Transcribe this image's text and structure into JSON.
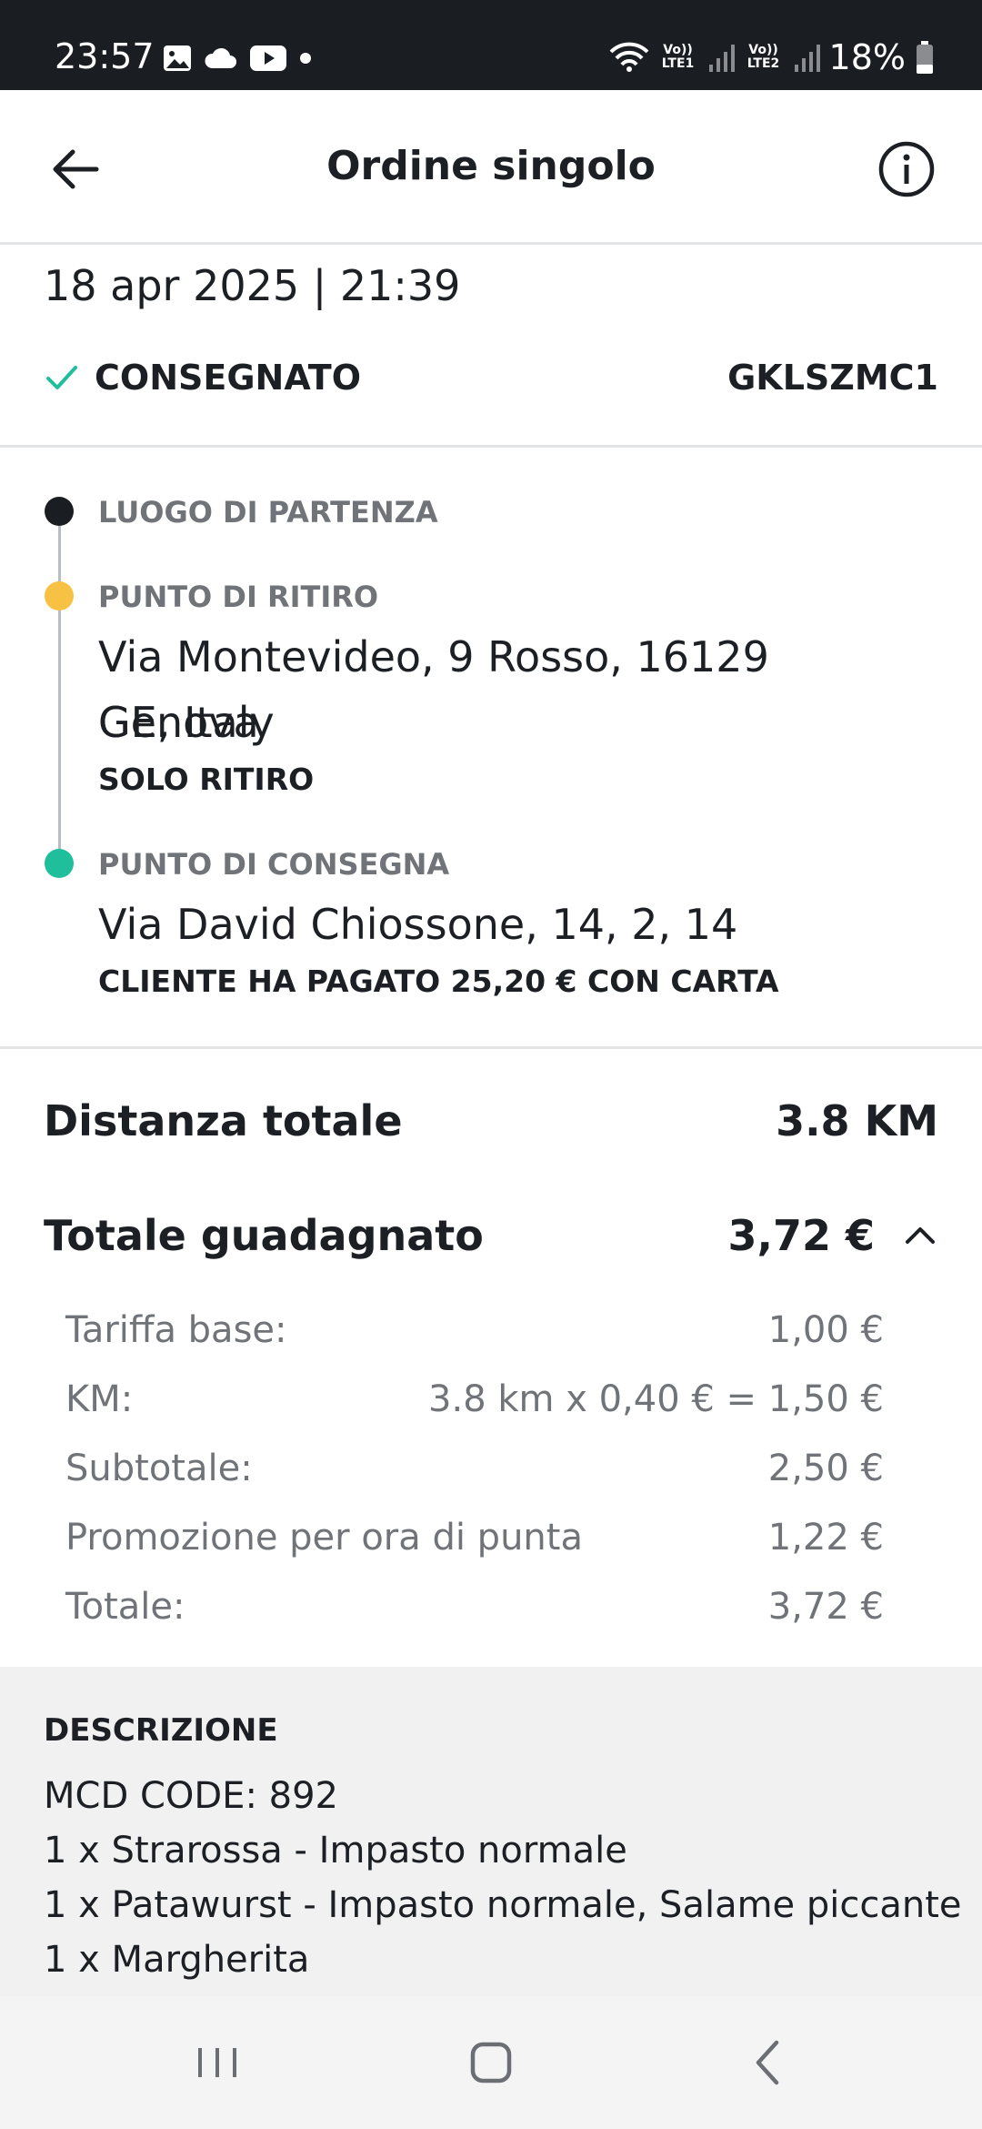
{
  "status_bar": {
    "time": "23:57",
    "lte1": "Vo)) LTE1",
    "lte2": "Vo)) LTE2",
    "battery": "18%"
  },
  "header": {
    "title": "Ordine singolo"
  },
  "order": {
    "datetime": "18 apr 2025 | 21:39",
    "status": "CONSEGNATO",
    "code": "GKLSZMC1"
  },
  "route": {
    "start_label": "LUOGO DI PARTENZA",
    "pickup_label": "PUNTO DI RITIRO",
    "pickup_address_line1": "Via Montevideo, 9 Rosso, 16129 Genova",
    "pickup_address_line2": "GE, Italy",
    "pickup_note": "SOLO RITIRO",
    "dropoff_label": "PUNTO DI CONSEGNA",
    "dropoff_address": "Via David Chiossone, 14, 2, 14",
    "dropoff_note": "CLIENTE HA PAGATO 25,20 € CON CARTA"
  },
  "totals": {
    "distance_label": "Distanza totale",
    "distance_value": "3.8 KM",
    "earned_label": "Totale guadagnato",
    "earned_value": "3,72 €",
    "breakdown": [
      {
        "label": "Tariffa base:",
        "value": "1,00 €"
      },
      {
        "label": "KM:",
        "value": "3.8 km x 0,40 € = 1,50 €"
      },
      {
        "label": "Subtotale:",
        "value": "2,50 €"
      },
      {
        "label": "Promozione per ora di punta",
        "value": "1,22 €"
      },
      {
        "label": "Totale:",
        "value": "3,72 €"
      }
    ]
  },
  "description": {
    "heading": "DESCRIZIONE",
    "lines": [
      "MCD CODE: 892",
      "1 x Strarossa - Impasto normale",
      "1 x Patawurst - Impasto normale, Salame piccante",
      "1 x Margherita"
    ]
  },
  "colors": {
    "status_bar_bg": "#1a1d22",
    "start_dot": "#1a1d22",
    "pickup_dot": "#f7c143",
    "dropoff_dot": "#1fbf9c",
    "check": "#1fbf9c",
    "muted_text": "#707378",
    "description_bg": "#f1f1f2"
  },
  "icons": [
    "image-icon",
    "cloud-icon",
    "youtube-icon",
    "wifi-icon",
    "signal-icon",
    "battery-icon",
    "back-arrow-icon",
    "info-icon",
    "check-icon",
    "chevron-up-icon",
    "recent-apps-icon",
    "home-icon",
    "nav-back-icon"
  ]
}
